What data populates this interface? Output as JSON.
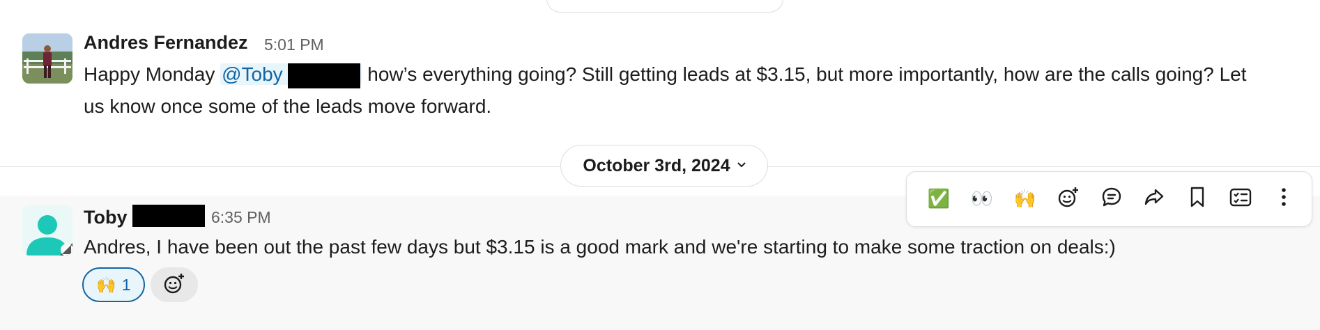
{
  "message1": {
    "author": "Andres Fernandez",
    "time": "5:01 PM",
    "text_before": "Happy Monday ",
    "mention": "@Toby",
    "text_after_line1": " how’s everything going? Still getting leads at $3.15, but more importantly, how are the calls going? Let",
    "text_line2": "us know once some of the leads move forward."
  },
  "date_divider": {
    "label": "October 3rd, 2024"
  },
  "message2": {
    "author": "Toby",
    "time": "6:35 PM",
    "text": "Andres, I have been out the past few days but $3.15 is a good mark and we're starting to make some traction on deals:)",
    "reactions": [
      {
        "emoji": "🙌",
        "count": "1"
      }
    ]
  },
  "toolbar": {
    "quick_reactions": [
      "✅",
      "👀",
      "🙌"
    ],
    "actions": [
      "add-reaction",
      "reply-in-thread",
      "forward",
      "save",
      "add-to-list",
      "more-actions"
    ]
  }
}
